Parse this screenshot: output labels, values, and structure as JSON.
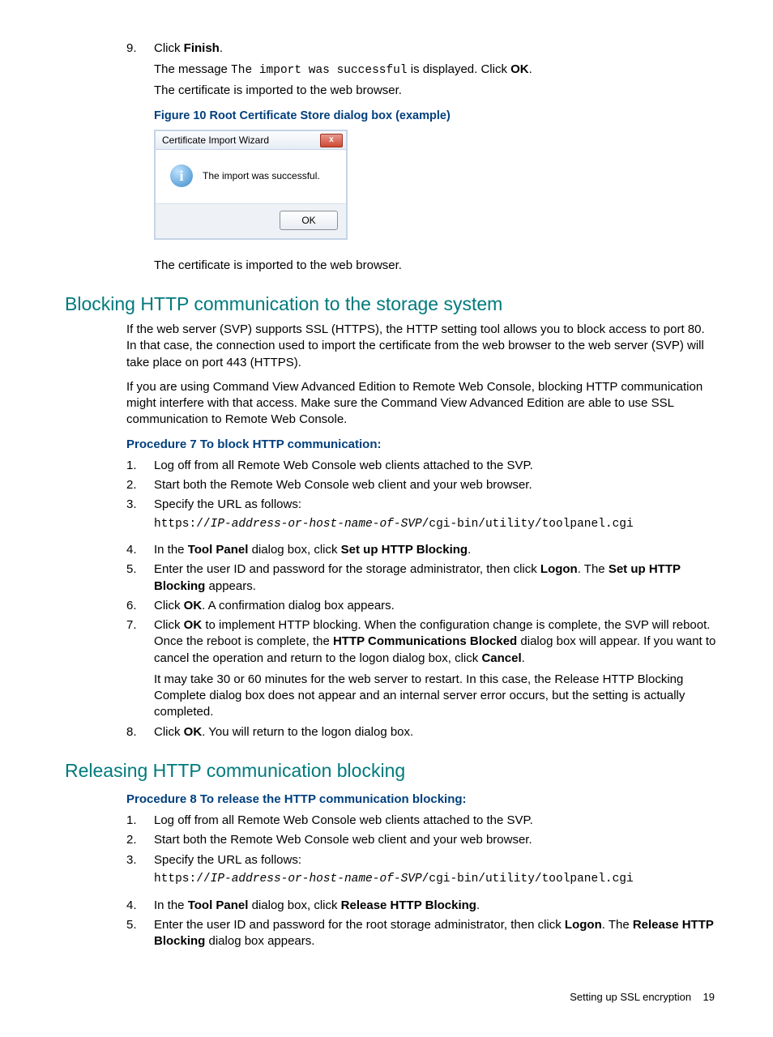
{
  "step9": {
    "num": "9.",
    "line1_a": "Click ",
    "line1_b": "Finish",
    "line1_c": ".",
    "line2_a": "The message ",
    "line2_b": "The import was successful",
    "line2_c": " is displayed. Click ",
    "line2_d": "OK",
    "line2_e": ".",
    "line3": "The certificate is imported to the web browser."
  },
  "figure": {
    "caption": "Figure 10 Root Certificate Store dialog box (example)",
    "title": "Certificate Import Wizard",
    "msg": "The import was successful.",
    "ok": "OK",
    "close": "x",
    "info": "i"
  },
  "after_fig": "The certificate is imported to the web browser.",
  "h2_block": "Blocking HTTP communication to the storage system",
  "block_p1": "If the web server (SVP) supports SSL (HTTPS), the HTTP setting tool allows you to block access to port 80. In that case, the connection used to import the certificate from the web browser to the web server (SVP) will take place on port 443 (HTTPS).",
  "block_p2": "If you are using Command View Advanced Edition to Remote Web Console, blocking HTTP communication might interfere with that access. Make sure the Command View Advanced Edition are able to use SSL communication to Remote Web Console.",
  "proc7_title": "Procedure 7 To block HTTP communication:",
  "proc7": {
    "n1": "1.",
    "t1": "Log off from all Remote Web Console web clients attached to the SVP.",
    "n2": "2.",
    "t2": "Start both the Remote Web Console web client and your web browser.",
    "n3": "3.",
    "t3": "Specify the URL as follows:",
    "t3_code_a": "https://",
    "t3_code_b": "IP-address-or-host-name-of-SVP",
    "t3_code_c": "/cgi-bin/utility/toolpanel.cgi",
    "n4": "4.",
    "t4_a": "In the ",
    "t4_b": "Tool Panel",
    "t4_c": " dialog box, click ",
    "t4_d": "Set up HTTP Blocking",
    "t4_e": ".",
    "n5": "5.",
    "t5_a": "Enter the user ID and password for the storage administrator, then click ",
    "t5_b": "Logon",
    "t5_c": ". The ",
    "t5_d": "Set up HTTP Blocking",
    "t5_e": " appears.",
    "n6": "6.",
    "t6_a": "Click ",
    "t6_b": "OK",
    "t6_c": ". A confirmation dialog box appears.",
    "n7": "7.",
    "t7_a": "Click ",
    "t7_b": "OK",
    "t7_c": " to implement HTTP blocking. When the configuration change is complete, the SVP will reboot. Once the reboot is complete, the ",
    "t7_d": "HTTP Communications Blocked",
    "t7_e": " dialog box will appear. If you want to cancel the operation and return to the logon dialog box, click ",
    "t7_f": "Cancel",
    "t7_g": ".",
    "t7_p2": "It may take 30 or 60 minutes for the web server to restart. In this case, the Release HTTP Blocking Complete dialog box does not appear and an internal server error occurs, but the setting is actually completed.",
    "n8": "8.",
    "t8_a": "Click ",
    "t8_b": "OK",
    "t8_c": ". You will return to the logon dialog box."
  },
  "h2_release": "Releasing HTTP communication blocking",
  "proc8_title": "Procedure 8 To release the HTTP communication blocking:",
  "proc8": {
    "n1": "1.",
    "t1": "Log off from all Remote Web Console web clients attached to the SVP.",
    "n2": "2.",
    "t2": "Start both the Remote Web Console web client and your web browser.",
    "n3": "3.",
    "t3": "Specify the URL as follows:",
    "t3_code_a": "https://",
    "t3_code_b": "IP-address-or-host-name-of-SVP",
    "t3_code_c": "/cgi-bin/utility/toolpanel.cgi",
    "n4": "4.",
    "t4_a": "In the ",
    "t4_b": "Tool Panel",
    "t4_c": " dialog box, click ",
    "t4_d": "Release HTTP Blocking",
    "t4_e": ".",
    "n5": "5.",
    "t5_a": "Enter the user ID and password for the root storage administrator, then click ",
    "t5_b": "Logon",
    "t5_c": ". The ",
    "t5_d": "Release HTTP Blocking",
    "t5_e": " dialog box appears."
  },
  "footer_a": "Setting up SSL encryption",
  "footer_b": "19"
}
